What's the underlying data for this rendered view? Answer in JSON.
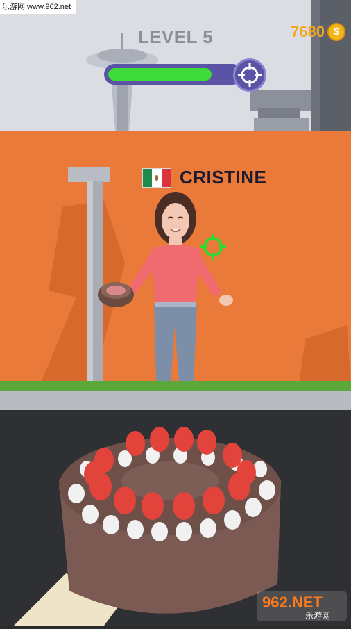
{
  "watermark": {
    "top_text": "乐游网 www.962.net",
    "logo_text": "962.NET",
    "logo_sub": "乐游网"
  },
  "hud": {
    "level_label": "LEVEL 5",
    "coins": "7680",
    "coin_symbol": "$",
    "progress": 0.82
  },
  "opponent": {
    "name": "CRISTINE",
    "flag": "mexico-flag"
  },
  "icons": {
    "target": "crosshair-icon",
    "coin": "coin-icon"
  },
  "colors": {
    "progress_fill": "#3ddc3a",
    "progress_track": "#5a53a6",
    "wall": "#ea7a3a",
    "coin": "#f0a722"
  }
}
